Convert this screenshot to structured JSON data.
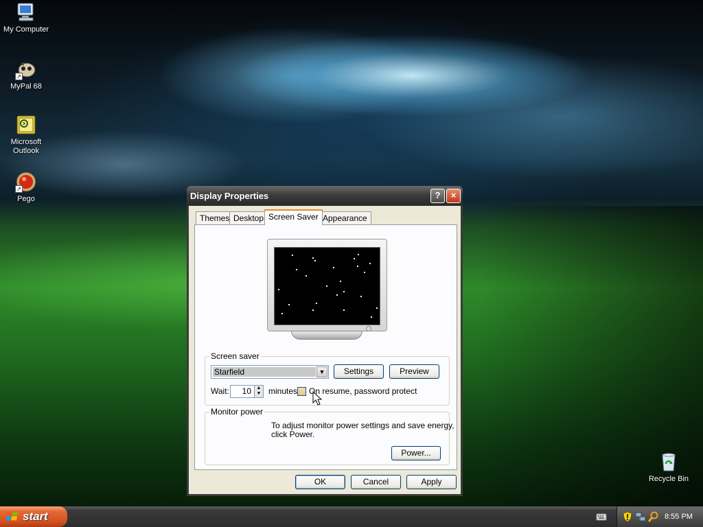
{
  "desktop": {
    "icons": [
      {
        "label": "My Computer"
      },
      {
        "label": "MyPal 68"
      },
      {
        "label": "Microsoft Outlook"
      },
      {
        "label": "Pego"
      },
      {
        "label": "Recycle Bin"
      }
    ]
  },
  "window": {
    "title": "Display Properties",
    "help_glyph": "?",
    "close_glyph": "×",
    "tabs": [
      {
        "label": "Themes",
        "active": false
      },
      {
        "label": "Desktop",
        "active": false
      },
      {
        "label": "Screen Saver",
        "active": true
      },
      {
        "label": "Appearance",
        "active": false
      }
    ],
    "screen_saver": {
      "group_label": "Screen saver",
      "selected": "Starfield",
      "settings_label": "Settings",
      "preview_label": "Preview",
      "wait_label": "Wait:",
      "wait_value": "10",
      "minutes_label": "minutes",
      "password_label": "On resume, password protect",
      "password_checked": false
    },
    "monitor_power": {
      "group_label": "Monitor power",
      "description_line1": "To adjust monitor power settings and save energy,",
      "description_line2": "click Power.",
      "power_label": "Power..."
    },
    "footer": {
      "ok_label": "OK",
      "cancel_label": "Cancel",
      "apply_label": "Apply"
    }
  },
  "taskbar": {
    "start_label": "start",
    "clock": "8:55 PM"
  },
  "icons": {
    "my_computer": "computer-icon",
    "mypal": "mypal-browser-icon",
    "outlook": "outlook-icon",
    "pego": "pego-icon",
    "recycle_bin": "recycle-bin-icon",
    "tray": [
      "keyboard-icon",
      "security-shield-icon",
      "network-icon",
      "search-icon"
    ]
  },
  "colors": {
    "start_button": "#d3501f",
    "tab_active_accent": "#e68b2c",
    "dialog_bg": "#ece9d8",
    "titlebar": "#3c3c3c"
  }
}
